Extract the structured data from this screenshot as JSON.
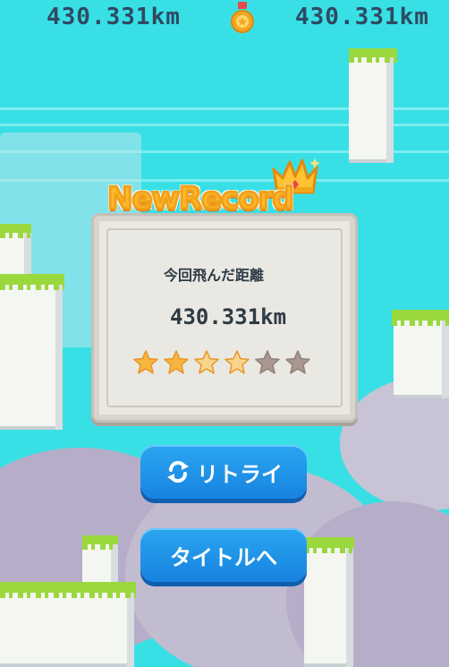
{
  "hud": {
    "distance_left": "430.331km",
    "distance_right": "430.331km",
    "medal_icon": "medal-icon"
  },
  "result": {
    "banner": "NewRecord",
    "label": "今回飛んだ距離",
    "distance": "430.331km",
    "stars_total": 6,
    "stars_earned": 4
  },
  "buttons": {
    "retry_label": "リトライ",
    "title_label": "タイトルへ"
  },
  "colors": {
    "sky": "#38e0e6",
    "button": "#1f95e8",
    "banner": "#ffb62a",
    "grass": "#9bd83e"
  }
}
